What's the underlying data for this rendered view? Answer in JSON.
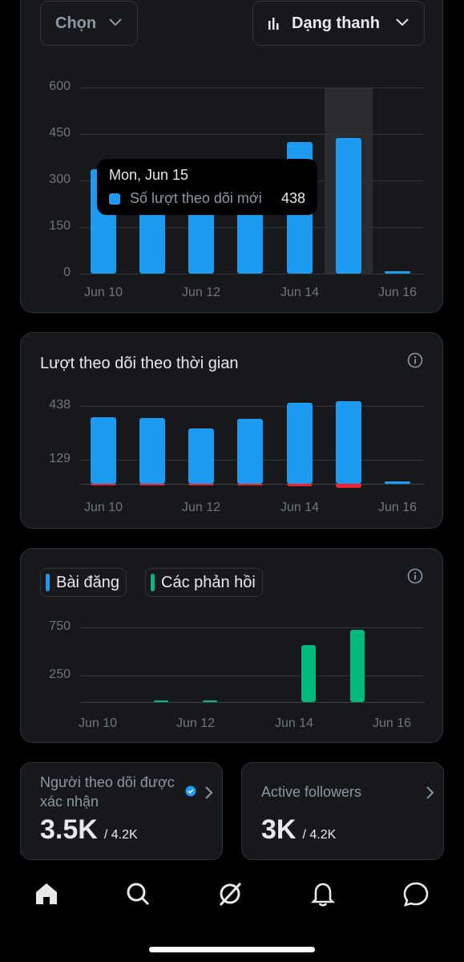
{
  "top_chart": {
    "select_label": "Chọn",
    "chart_type_label": "Dạng thanh",
    "tooltip": {
      "date": "Mon, Jun 15",
      "series_label": "Số lượt theo dõi mới",
      "value": "438"
    }
  },
  "follows_card": {
    "title": "Lượt theo dõi theo thời gian"
  },
  "posts_card": {
    "legend": [
      "Bài đăng",
      "Các phản hồi"
    ]
  },
  "stats": [
    {
      "title": "Người theo dõi được xác nhận",
      "value": "3.5K",
      "total": "/ 4.2K"
    },
    {
      "title": "Active followers",
      "value": "3K",
      "total": "/ 4.2K"
    }
  ],
  "chart_data": [
    {
      "type": "bar",
      "title": "",
      "categories": [
        "Jun 10",
        "Jun 11",
        "Jun 12",
        "Jun 13",
        "Jun 14",
        "Jun 15",
        "Jun 16"
      ],
      "x_tick_labels": [
        "Jun 10",
        "Jun 12",
        "Jun 14",
        "Jun 16"
      ],
      "series": [
        {
          "name": "Số lượt theo dõi mới",
          "values": [
            335,
            300,
            300,
            300,
            425,
            438,
            5
          ]
        }
      ],
      "ylim": [
        0,
        600
      ],
      "yticks": [
        "0",
        "150",
        "300",
        "450",
        "600"
      ],
      "highlight_category": "Jun 15"
    },
    {
      "type": "bar",
      "title": "Lượt theo dõi theo thời gian",
      "categories": [
        "Jun 10",
        "Jun 11",
        "Jun 12",
        "Jun 13",
        "Jun 14",
        "Jun 15",
        "Jun 16"
      ],
      "x_tick_labels": [
        "Jun 10",
        "Jun 12",
        "Jun 14",
        "Jun 16"
      ],
      "series": [
        {
          "values": [
            375,
            370,
            310,
            365,
            455,
            465,
            5
          ]
        },
        {
          "values": [
            -12,
            -10,
            -8,
            -6,
            -15,
            -25,
            0
          ]
        }
      ],
      "yticks": [
        "129",
        "438"
      ]
    },
    {
      "type": "bar",
      "title": "",
      "categories": [
        "Jun 10",
        "Jun 11",
        "Jun 12",
        "Jun 13",
        "Jun 14",
        "Jun 15",
        "Jun 16"
      ],
      "x_tick_labels": [
        "Jun 10",
        "Jun 12",
        "Jun 14",
        "Jun 16"
      ],
      "series": [
        {
          "name": "Bài đăng",
          "values": [
            0,
            0,
            0,
            0,
            0,
            0,
            0
          ]
        },
        {
          "name": "Các phản hồi",
          "values": [
            0,
            5,
            5,
            0,
            590,
            750,
            0
          ]
        }
      ],
      "yticks": [
        "250",
        "750"
      ]
    }
  ],
  "colors": {
    "blue": "#1d9bf0",
    "green": "#00ba7c",
    "red": "#f4212e",
    "card_bg": "#16181c",
    "border": "#2f3336"
  },
  "nav": [
    "home-icon",
    "search-icon",
    "grok-icon",
    "notifications-icon",
    "messages-icon"
  ]
}
